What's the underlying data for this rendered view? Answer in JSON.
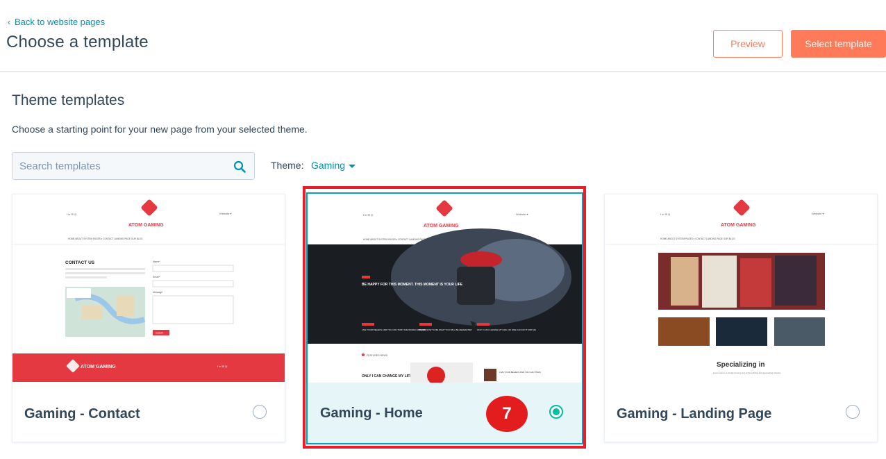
{
  "header": {
    "back_label": "Back to website pages",
    "title": "Choose a template",
    "preview_label": "Preview",
    "select_label": "Select template"
  },
  "section": {
    "title": "Theme templates",
    "description": "Choose a starting point for your new page from your selected theme."
  },
  "search": {
    "placeholder": "Search templates"
  },
  "theme": {
    "label": "Theme:",
    "value": "Gaming"
  },
  "cards": [
    {
      "name": "Gaming - Contact",
      "selected": false,
      "preview": {
        "brand": "ATOM GAMING",
        "nav": "HOME   ABOUT   SYSTEM PAGES ▾   CONTACT   LANDING PAGE   OUR BLOG",
        "heading": "CONTACT US",
        "field_name": "Name*",
        "field_email": "Email*",
        "field_message": "Message",
        "submit": "SUBMIT",
        "footer_brand": "ATOM GAMING"
      }
    },
    {
      "name": "Gaming - Home",
      "selected": true,
      "preview": {
        "brand": "ATOM GAMING",
        "nav": "HOME   ABOUT   SYSTEM PAGES ▾   CONTACT   LANDING PAGE   OUR BLOG",
        "hero_title": "BE HAPPY FOR THIS MOMENT. THIS MOMENT IS YOUR LIFE",
        "post1": "LIVE YOUR BELIEFS AND YOU CAN TURN THE WORLD AROUND",
        "post2": "BEGIN NOW TO BE WHAT YOU WILL BE HEREAFTER",
        "post3": "ONLY I CAN CHANGE MY LIFE. NO ONE CAN DO IT FOR ME",
        "featured": "FEATURED NEWS",
        "featured_title": "ONLY I CAN CHANGE MY LIFE. NO ONE CAN",
        "side_post": "LIVE YOUR BELIEFS AND YOU CAN TURN"
      }
    },
    {
      "name": "Gaming - Landing Page",
      "selected": false,
      "preview": {
        "brand": "ATOM GAMING",
        "nav": "HOME   ABOUT   SYSTEM PAGES ▾   CONTACT   LANDING PAGE   OUR BLOG",
        "heading": "Specializing in",
        "subtext": "Lorem ipsum is simply dummy text of the printing and typesetting industry."
      }
    }
  ],
  "annotation": {
    "step": "7"
  },
  "colors": {
    "accent": "#ff7a59",
    "link": "#0091ae",
    "brand_red": "#e53941",
    "highlight": "#e61e2b",
    "selected_radio": "#00bda5"
  }
}
